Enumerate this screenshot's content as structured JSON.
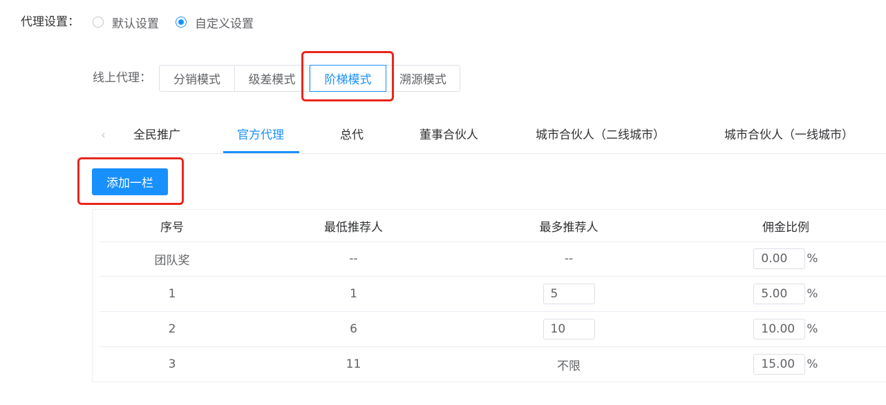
{
  "settings": {
    "label": "代理设置：",
    "options": [
      {
        "label": "默认设置",
        "checked": false
      },
      {
        "label": "自定义设置",
        "checked": true
      }
    ]
  },
  "online": {
    "label": "线上代理：",
    "modes": [
      {
        "label": "分销模式",
        "active": false
      },
      {
        "label": "级差模式",
        "active": false
      },
      {
        "label": "阶梯模式",
        "active": true
      },
      {
        "label": "溯源模式",
        "active": false
      }
    ]
  },
  "tabs": {
    "prev_icon": "‹",
    "items": [
      {
        "label": "全民推广",
        "active": false
      },
      {
        "label": "官方代理",
        "active": true
      },
      {
        "label": "总代",
        "active": false
      },
      {
        "label": "董事合伙人",
        "active": false
      },
      {
        "label": "城市合伙人（二线城市）",
        "active": false
      },
      {
        "label": "城市合伙人（一线城市）",
        "active": false
      }
    ]
  },
  "add_button": "添加一栏",
  "table": {
    "headers": [
      "序号",
      "最低推荐人",
      "最多推荐人",
      "佣金比例"
    ],
    "percent": "%",
    "rows": [
      {
        "index": "团队奖",
        "min": "--",
        "max": "--",
        "max_editable": false,
        "rate": "0.00"
      },
      {
        "index": "1",
        "min": "1",
        "max": "5",
        "max_editable": true,
        "rate": "5.00"
      },
      {
        "index": "2",
        "min": "6",
        "max": "10",
        "max_editable": true,
        "rate": "10.00"
      },
      {
        "index": "3",
        "min": "11",
        "max": "不限",
        "max_editable": false,
        "rate": "15.00"
      }
    ]
  },
  "colors": {
    "accent": "#1890ff",
    "highlight": "#e8261c"
  }
}
